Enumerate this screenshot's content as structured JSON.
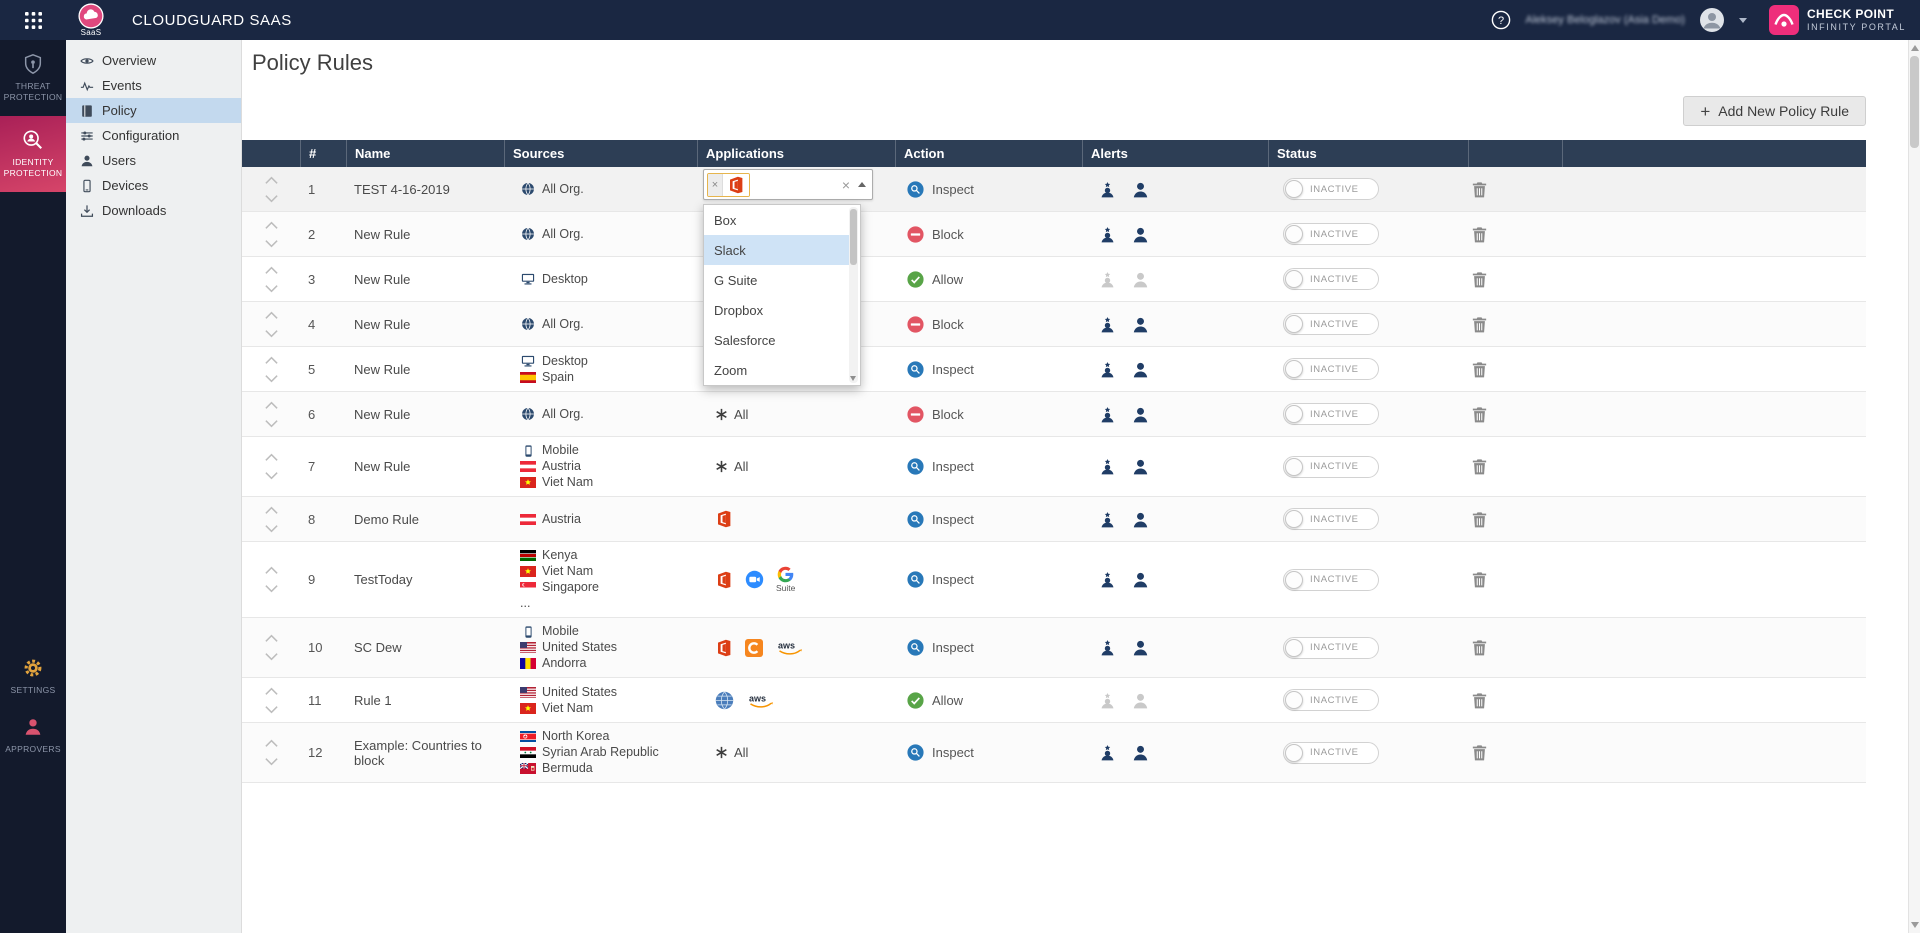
{
  "topbar": {
    "app_title": "CLOUDGUARD SAAS",
    "logo_sub": "SaaS",
    "user_name": "Aleksey Beloglazov (Asia Demo)",
    "brand_line1": "CHECK POINT",
    "brand_line2": "INFINITY PORTAL"
  },
  "rail": {
    "items": [
      {
        "label": "THREAT PROTECTION",
        "icon": "shield-icon",
        "active": false
      },
      {
        "label": "IDENTITY PROTECTION",
        "icon": "identity-search-icon",
        "active": true
      }
    ],
    "bottom_items": [
      {
        "label": "SETTINGS",
        "icon": "gear-icon"
      },
      {
        "label": "APPROVERS",
        "icon": "approver-icon"
      }
    ]
  },
  "nav": {
    "items": [
      {
        "label": "Overview",
        "icon": "overview",
        "active": false
      },
      {
        "label": "Events",
        "icon": "events",
        "active": false
      },
      {
        "label": "Policy",
        "icon": "policy",
        "active": true
      },
      {
        "label": "Configuration",
        "icon": "configuration",
        "active": false
      },
      {
        "label": "Users",
        "icon": "users",
        "active": false
      },
      {
        "label": "Devices",
        "icon": "devices",
        "active": false
      },
      {
        "label": "Downloads",
        "icon": "downloads",
        "active": false
      }
    ]
  },
  "page": {
    "title": "Policy Rules",
    "add_button_label": "Add New Policy Rule"
  },
  "table": {
    "columns": [
      "#",
      "Name",
      "Sources",
      "Applications",
      "Action",
      "Alerts",
      "Status"
    ],
    "rows": [
      {
        "num": "1",
        "name": "TEST 4-16-2019",
        "sources": [
          {
            "icon": "globe",
            "label": "All Org."
          }
        ],
        "apps": [],
        "action": "Inspect",
        "alerts_muted": false,
        "status": "INACTIVE",
        "selected": true
      },
      {
        "num": "2",
        "name": "New Rule",
        "sources": [
          {
            "icon": "globe",
            "label": "All Org."
          }
        ],
        "apps": [],
        "action": "Block",
        "alerts_muted": false,
        "status": "INACTIVE",
        "selected": false
      },
      {
        "num": "3",
        "name": "New Rule",
        "sources": [
          {
            "icon": "desktop",
            "label": "Desktop"
          }
        ],
        "apps": [],
        "action": "Allow",
        "alerts_muted": true,
        "status": "INACTIVE",
        "selected": false
      },
      {
        "num": "4",
        "name": "New Rule",
        "sources": [
          {
            "icon": "globe",
            "label": "All Org."
          }
        ],
        "apps": [],
        "action": "Block",
        "alerts_muted": false,
        "status": "INACTIVE",
        "selected": false
      },
      {
        "num": "5",
        "name": "New Rule",
        "sources": [
          {
            "icon": "desktop",
            "label": "Desktop"
          },
          {
            "icon": "flag-es",
            "label": "Spain"
          }
        ],
        "apps": [],
        "action": "Inspect",
        "alerts_muted": false,
        "status": "INACTIVE",
        "selected": false
      },
      {
        "num": "6",
        "name": "New Rule",
        "sources": [
          {
            "icon": "globe",
            "label": "All Org."
          }
        ],
        "apps": [
          {
            "icon": "all-apps",
            "label": "All"
          }
        ],
        "action": "Block",
        "alerts_muted": false,
        "status": "INACTIVE",
        "selected": false
      },
      {
        "num": "7",
        "name": "New Rule",
        "sources": [
          {
            "icon": "mobile",
            "label": "Mobile"
          },
          {
            "icon": "flag-at",
            "label": "Austria"
          },
          {
            "icon": "flag-vn",
            "label": "Viet Nam"
          }
        ],
        "apps": [
          {
            "icon": "all-apps",
            "label": "All"
          }
        ],
        "action": "Inspect",
        "alerts_muted": false,
        "status": "INACTIVE",
        "selected": false
      },
      {
        "num": "8",
        "name": "Demo Rule",
        "sources": [
          {
            "icon": "flag-at",
            "label": "Austria"
          }
        ],
        "apps": [
          {
            "icon": "office365"
          }
        ],
        "action": "Inspect",
        "alerts_muted": false,
        "status": "INACTIVE",
        "selected": false
      },
      {
        "num": "9",
        "name": "TestToday",
        "sources": [
          {
            "icon": "flag-ke",
            "label": "Kenya"
          },
          {
            "icon": "flag-vn",
            "label": "Viet Nam"
          },
          {
            "icon": "flag-sg",
            "label": "Singapore"
          },
          {
            "icon": "more",
            "label": "..."
          }
        ],
        "apps": [
          {
            "icon": "office365"
          },
          {
            "icon": "zoom"
          },
          {
            "icon": "gsuite",
            "sublabel": "Suite"
          }
        ],
        "action": "Inspect",
        "alerts_muted": false,
        "status": "INACTIVE",
        "selected": false
      },
      {
        "num": "10",
        "name": "SC Dew",
        "sources": [
          {
            "icon": "mobile",
            "label": "Mobile"
          },
          {
            "icon": "flag-us",
            "label": "United States"
          },
          {
            "icon": "flag-ad",
            "label": "Andorra"
          }
        ],
        "apps": [
          {
            "icon": "office365"
          },
          {
            "icon": "cloud-c"
          },
          {
            "icon": "aws"
          }
        ],
        "action": "Inspect",
        "alerts_muted": false,
        "status": "INACTIVE",
        "selected": false
      },
      {
        "num": "11",
        "name": "Rule 1",
        "sources": [
          {
            "icon": "flag-us",
            "label": "United States"
          },
          {
            "icon": "flag-vn",
            "label": "Viet Nam"
          }
        ],
        "apps": [
          {
            "icon": "web-app"
          },
          {
            "icon": "aws"
          }
        ],
        "action": "Allow",
        "alerts_muted": true,
        "status": "INACTIVE",
        "selected": false
      },
      {
        "num": "12",
        "name": "Example: Countries to block",
        "sources": [
          {
            "icon": "flag-kp",
            "label": "North Korea"
          },
          {
            "icon": "flag-sy",
            "label": "Syrian Arab Republic"
          },
          {
            "icon": "flag-bm",
            "label": "Bermuda"
          }
        ],
        "apps": [
          {
            "icon": "all-apps",
            "label": "All"
          }
        ],
        "action": "Inspect",
        "alerts_muted": false,
        "status": "INACTIVE",
        "selected": false
      }
    ]
  },
  "dropdown": {
    "chip_icon": "office365",
    "chip_remove_label": "×",
    "clear_label": "×",
    "options": [
      {
        "label": "Box",
        "highlighted": false
      },
      {
        "label": "Slack",
        "highlighted": true
      },
      {
        "label": "G Suite",
        "highlighted": false
      },
      {
        "label": "Dropbox",
        "highlighted": false
      },
      {
        "label": "Salesforce",
        "highlighted": false
      },
      {
        "label": "Zoom",
        "highlighted": false
      }
    ]
  },
  "colors": {
    "topbar_bg": "#1a2742",
    "rail_bg": "#131a2c",
    "accent_pink": "#c92a62",
    "table_header_bg": "#2d3e55",
    "active_nav_bg": "#c3d9ee",
    "inspect_blue": "#2878b8",
    "block_red": "#e25563",
    "allow_green": "#58a447",
    "alert_navy": "#203d66"
  }
}
